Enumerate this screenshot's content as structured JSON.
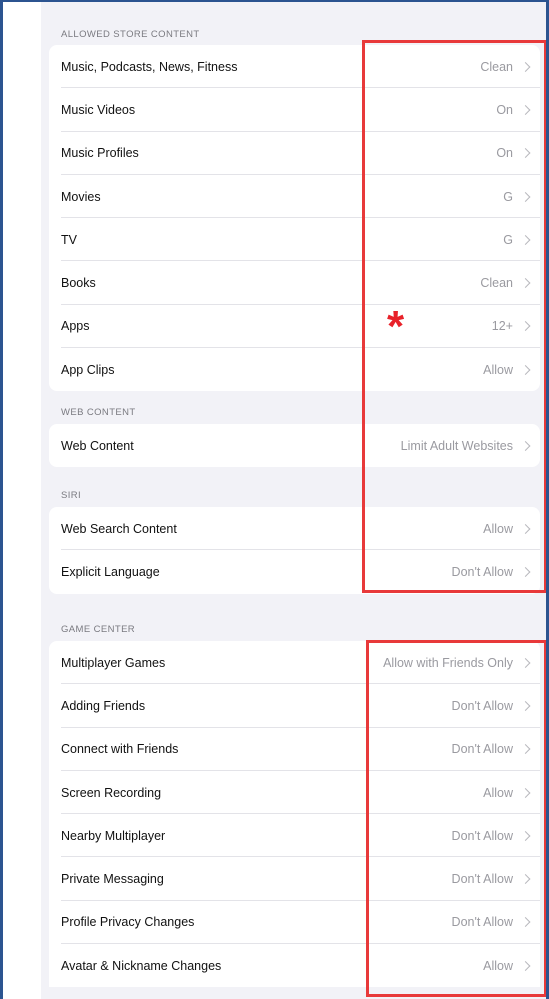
{
  "sections": {
    "store": {
      "header": "ALLOWED STORE CONTENT",
      "rows": [
        {
          "label": "Music, Podcasts, News, Fitness",
          "value": "Clean"
        },
        {
          "label": "Music Videos",
          "value": "On"
        },
        {
          "label": "Music Profiles",
          "value": "On"
        },
        {
          "label": "Movies",
          "value": "G"
        },
        {
          "label": "TV",
          "value": "G"
        },
        {
          "label": "Books",
          "value": "Clean"
        },
        {
          "label": "Apps",
          "value": "12+"
        },
        {
          "label": "App Clips",
          "value": "Allow"
        }
      ]
    },
    "web": {
      "header": "WEB CONTENT",
      "rows": [
        {
          "label": "Web Content",
          "value": "Limit Adult Websites"
        }
      ]
    },
    "siri": {
      "header": "SIRI",
      "rows": [
        {
          "label": "Web Search Content",
          "value": "Allow"
        },
        {
          "label": "Explicit Language",
          "value": "Don't Allow"
        }
      ]
    },
    "game": {
      "header": "GAME CENTER",
      "rows": [
        {
          "label": "Multiplayer Games",
          "value": "Allow with Friends Only"
        },
        {
          "label": "Adding Friends",
          "value": "Don't Allow"
        },
        {
          "label": "Connect with Friends",
          "value": "Don't Allow"
        },
        {
          "label": "Screen Recording",
          "value": "Allow"
        },
        {
          "label": "Nearby Multiplayer",
          "value": "Don't Allow"
        },
        {
          "label": "Private Messaging",
          "value": "Don't Allow"
        },
        {
          "label": "Profile Privacy Changes",
          "value": "Don't Allow"
        },
        {
          "label": "Avatar & Nickname Changes",
          "value": "Allow"
        }
      ]
    }
  },
  "annotation": {
    "asterisk": "*",
    "color": "#e8393a"
  }
}
